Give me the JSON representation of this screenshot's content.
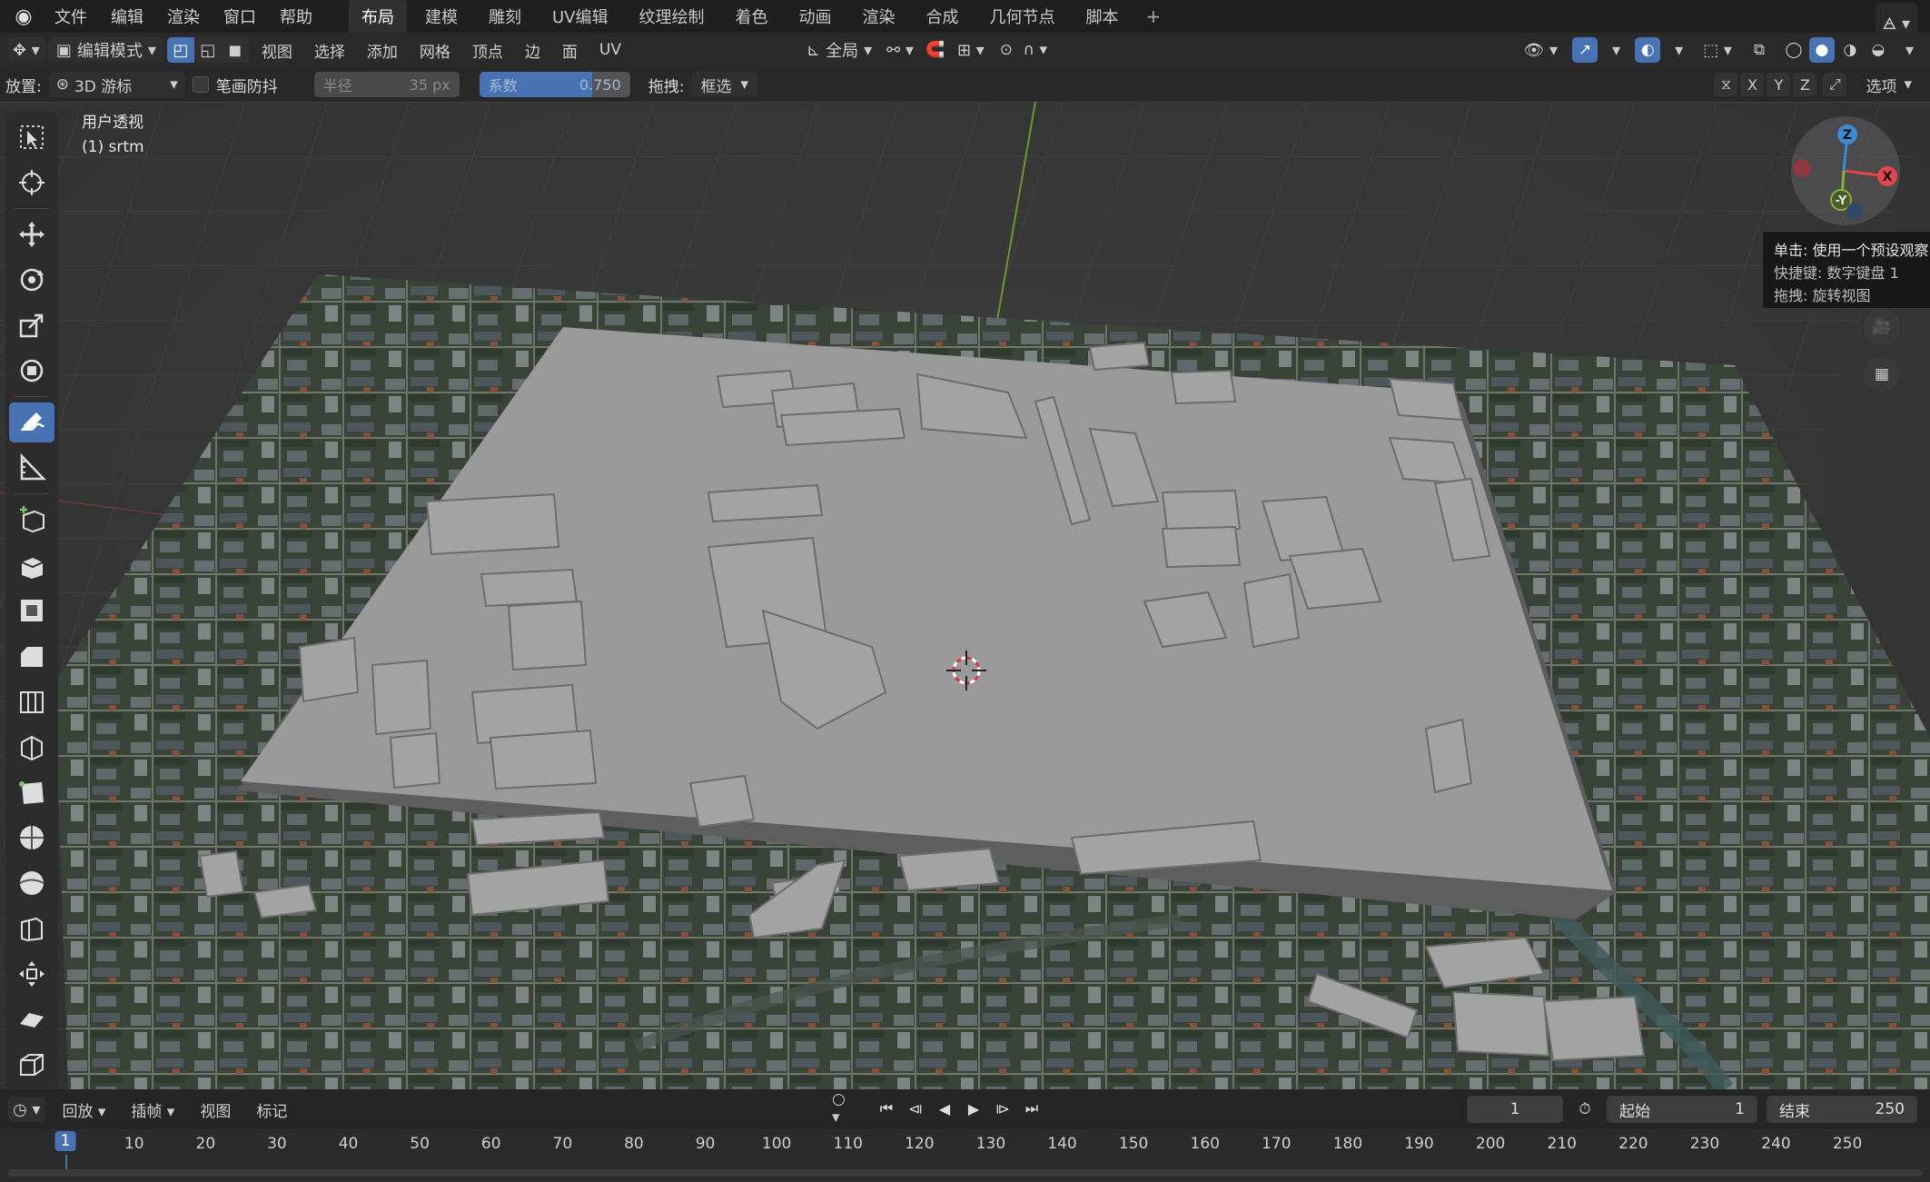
{
  "app": {
    "menus": [
      "文件",
      "编辑",
      "渲染",
      "窗口",
      "帮助"
    ],
    "workspaces": [
      "布局",
      "建模",
      "雕刻",
      "UV编辑",
      "纹理绘制",
      "着色",
      "动画",
      "渲染",
      "合成",
      "几何节点",
      "脚本"
    ],
    "active_workspace": "布局",
    "add_workspace": "+"
  },
  "header": {
    "mode": "编辑模式",
    "menus": [
      "视图",
      "选择",
      "添加",
      "网格",
      "顶点",
      "边",
      "面",
      "UV"
    ],
    "orientation": "全局"
  },
  "toolsettings": {
    "placement_label": "放置:",
    "placement_value": "3D 游标",
    "stroke_stabilize": "笔画防抖",
    "radius_label": "半径",
    "radius_value": "35 px",
    "factor_label": "系数",
    "factor_value": "0.750",
    "factor_fraction": 0.75,
    "drag_label": "拖拽:",
    "drag_value": "框选",
    "axes": [
      "X",
      "Y",
      "Z"
    ],
    "options": "选项"
  },
  "viewport": {
    "view_name": "用户透视",
    "object_name": "(1) srtm",
    "gizmo": {
      "z": "Z",
      "x": "X",
      "neg_y": "-Y"
    },
    "tooltip": {
      "line1": "单击: 使用一个预设观察",
      "line2": "快捷键: 数字键盘 1",
      "line3": "拖拽: 旋转视图"
    }
  },
  "timeline": {
    "menus": [
      "回放",
      "插帧",
      "视图",
      "标记"
    ],
    "current_frame": "1",
    "start_label": "起始",
    "start_value": "1",
    "end_label": "结束",
    "end_value": "250",
    "ruler": [
      "1",
      "10",
      "20",
      "30",
      "40",
      "50",
      "60",
      "70",
      "80",
      "90",
      "100",
      "110",
      "120",
      "130",
      "140",
      "150",
      "160",
      "170",
      "180",
      "190",
      "200",
      "210",
      "220",
      "230",
      "240",
      "250"
    ]
  },
  "colors": {
    "accent": "#4772b3",
    "x_axis": "#e0464b",
    "y_axis": "#84b23b",
    "z_axis": "#3a8ad6"
  }
}
